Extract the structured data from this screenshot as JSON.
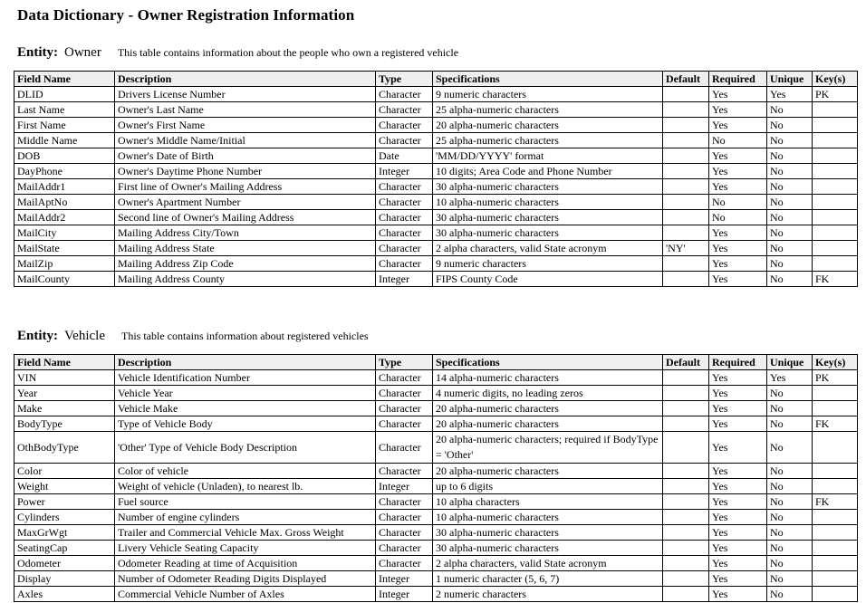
{
  "title": "Data Dictionary - Owner Registration Information",
  "columns": [
    "Field Name",
    "Description",
    "Type",
    "Specifications",
    "Default",
    "Required",
    "Unique",
    "Key(s)"
  ],
  "entities": [
    {
      "label": "Entity:",
      "name": "Owner",
      "description": "This table contains information about the people who own a registered vehicle",
      "rows": [
        [
          "DLID",
          "Drivers License Number",
          "Character",
          "9 numeric characters",
          "",
          "Yes",
          "Yes",
          "PK"
        ],
        [
          "Last Name",
          "Owner's Last Name",
          "Character",
          "25 alpha-numeric characters",
          "",
          "Yes",
          "No",
          ""
        ],
        [
          "First Name",
          "Owner's First Name",
          "Character",
          "20 alpha-numeric characters",
          "",
          "Yes",
          "No",
          ""
        ],
        [
          "Middle Name",
          "Owner's Middle Name/Initial",
          "Character",
          "25 alpha-numeric characters",
          "",
          "No",
          "No",
          ""
        ],
        [
          "DOB",
          "Owner's Date of Birth",
          "Date",
          "'MM/DD/YYYY' format",
          "",
          "Yes",
          "No",
          ""
        ],
        [
          "DayPhone",
          "Owner's Daytime Phone Number",
          "Integer",
          "10 digits; Area Code and Phone Number",
          "",
          "Yes",
          "No",
          ""
        ],
        [
          "MailAddr1",
          "First line of Owner's Mailing Address",
          "Character",
          "30 alpha-numeric characters",
          "",
          "Yes",
          "No",
          ""
        ],
        [
          "MailAptNo",
          "Owner's Apartment Number",
          "Character",
          "10 alpha-numeric characters",
          "",
          "No",
          "No",
          ""
        ],
        [
          "MailAddr2",
          "Second line of Owner's Mailing Address",
          "Character",
          "30 alpha-numeric characters",
          "",
          "No",
          "No",
          ""
        ],
        [
          "MailCity",
          "Mailing Address City/Town",
          "Character",
          "30 alpha-numeric characters",
          "",
          "Yes",
          "No",
          ""
        ],
        [
          "MailState",
          "Mailing Address State",
          "Character",
          "2 alpha characters, valid State acronym",
          "'NY'",
          "Yes",
          "No",
          ""
        ],
        [
          "MailZip",
          "Mailing Address Zip Code",
          "Character",
          "9 numeric characters",
          "",
          "Yes",
          "No",
          ""
        ],
        [
          "MailCounty",
          "Mailing Address County",
          "Integer",
          "FIPS County Code",
          "",
          "Yes",
          "No",
          "FK"
        ]
      ]
    },
    {
      "label": "Entity:",
      "name": "Vehicle",
      "description": "This table contains information about registered vehicles",
      "rows": [
        [
          "VIN",
          "Vehicle Identification Number",
          "Character",
          "14 alpha-numeric characters",
          "",
          "Yes",
          "Yes",
          "PK"
        ],
        [
          "Year",
          "Vehicle Year",
          "Character",
          "4 numeric digits, no leading zeros",
          "",
          "Yes",
          "No",
          ""
        ],
        [
          "Make",
          "Vehicle Make",
          "Character",
          "20 alpha-numeric characters",
          "",
          "Yes",
          "No",
          ""
        ],
        [
          "BodyType",
          "Type of Vehicle Body",
          "Character",
          "20 alpha-numeric characters",
          "",
          "Yes",
          "No",
          "FK"
        ],
        [
          "OthBodyType",
          "'Other' Type of Vehicle Body Description",
          "Character",
          "20 alpha-numeric characters; required if BodyType = 'Other'",
          "",
          "Yes",
          "No",
          ""
        ],
        [
          "Color",
          "Color of vehicle",
          "Character",
          "20 alpha-numeric characters",
          "",
          "Yes",
          "No",
          ""
        ],
        [
          "Weight",
          "Weight of vehicle (Unladen), to nearest lb.",
          "Integer",
          "up to 6 digits",
          "",
          "Yes",
          "No",
          ""
        ],
        [
          "Power",
          "Fuel source",
          "Character",
          "10 alpha characters",
          "",
          "Yes",
          "No",
          "FK"
        ],
        [
          "Cylinders",
          "Number of engine cylinders",
          "Character",
          "10 alpha-numeric characters",
          "",
          "Yes",
          "No",
          ""
        ],
        [
          "MaxGrWgt",
          "Trailer and Commercial Vehicle Max. Gross Weight",
          "Character",
          "30 alpha-numeric characters",
          "",
          "Yes",
          "No",
          ""
        ],
        [
          "SeatingCap",
          "Livery Vehicle Seating Capacity",
          "Character",
          "30 alpha-numeric characters",
          "",
          "Yes",
          "No",
          ""
        ],
        [
          "Odometer",
          "Odometer Reading at time of Acquisition",
          "Character",
          "2 alpha characters, valid State acronym",
          "",
          "Yes",
          "No",
          ""
        ],
        [
          "Display",
          "Number of Odometer Reading Digits Displayed",
          "Integer",
          "1 numeric character (5, 6, 7)",
          "",
          "Yes",
          "No",
          ""
        ],
        [
          "Axles",
          "Commercial Vehicle Number of Axles",
          "Integer",
          "2 numeric characters",
          "",
          "Yes",
          "No",
          ""
        ]
      ]
    }
  ]
}
